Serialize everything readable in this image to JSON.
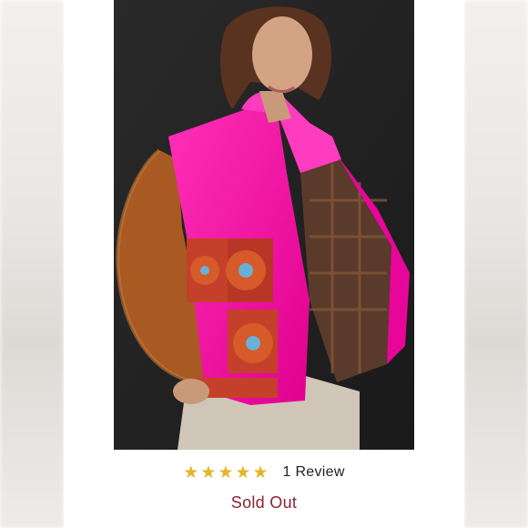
{
  "product": {
    "image_alt": "Woman wearing a hot pink puffer jacket with crochet flower squares and brown sherpa sleeves",
    "rating": {
      "stars": 5,
      "max": 5,
      "star_icon": "star-icon",
      "star_color": "#e5b52a"
    },
    "review_count_label": "1 Review",
    "status_label": "Sold Out",
    "status_color": "#8b2232"
  }
}
